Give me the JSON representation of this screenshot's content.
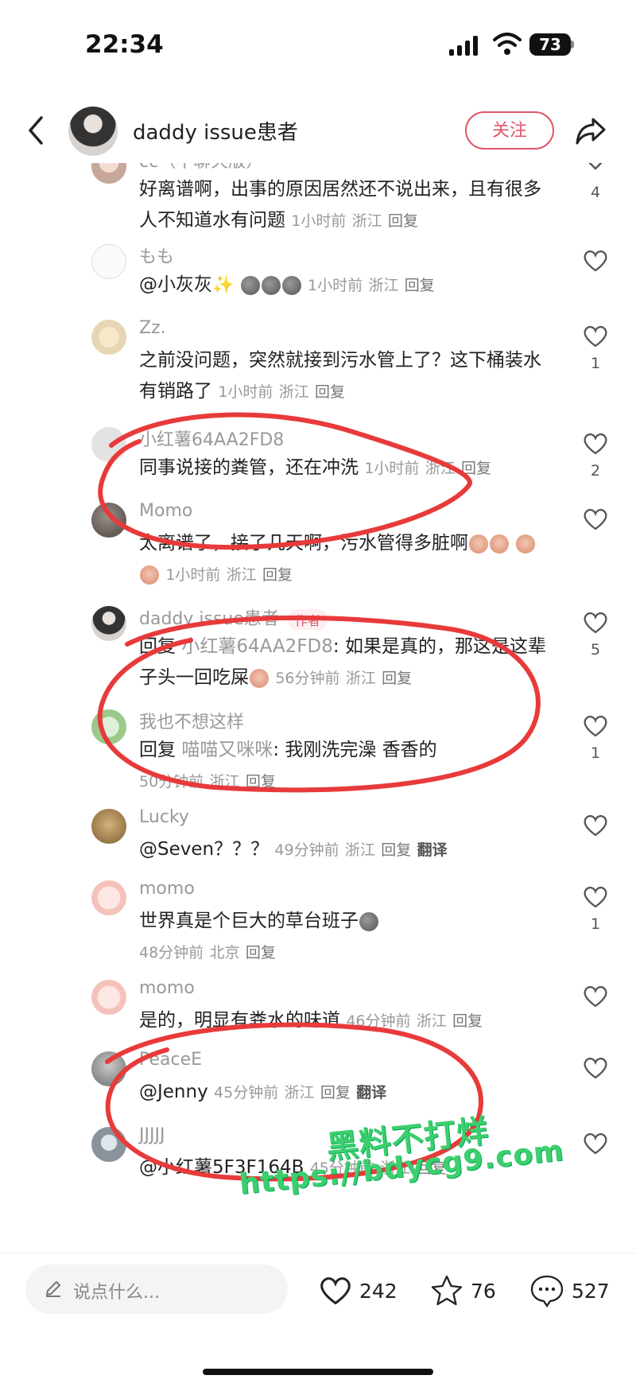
{
  "status_bar": {
    "time": "22:34",
    "battery": "73"
  },
  "header": {
    "username": "daddy issue患者",
    "follow_label": "关注"
  },
  "comments": [
    {
      "user": "cc（不聊天版）",
      "text": "好离谱啊，出事的原因居然还不说出来，且有很多人不知道水有问题",
      "time": "1小时前",
      "location": "浙江",
      "reply": "回复",
      "likes": "4"
    },
    {
      "user": "もも",
      "mention": "@小灰灰",
      "time": "1小时前",
      "location": "浙江",
      "reply": "回复",
      "likes": ""
    },
    {
      "user": "Zz.",
      "text": "之前没问题，突然就接到污水管上了？这下桶装水有销路了",
      "time": "1小时前",
      "location": "浙江",
      "reply": "回复",
      "likes": "1"
    },
    {
      "user": "小红薯64AA2FD8",
      "text": "同事说接的粪管，还在冲洗",
      "time": "1小时前",
      "location": "浙江",
      "reply": "回复",
      "likes": "2"
    },
    {
      "user": "Momo",
      "text": "太离谱了，接了几天啊，污水管得多脏啊",
      "time": "1小时前",
      "location": "浙江",
      "reply": "回复",
      "likes": ""
    },
    {
      "user": "daddy issue患者",
      "tag": "作者",
      "reply_prefix": "回复",
      "reply_to": "小红薯64AA2FD8",
      "text": ": 如果是真的，那这是这辈子头一回吃屎",
      "time": "56分钟前",
      "location": "浙江",
      "reply": "回复",
      "likes": "5"
    },
    {
      "user": "我也不想这样",
      "reply_prefix": "回复",
      "reply_to": "喵喵又咪咪",
      "text": ": 我刚洗完澡 香香的",
      "time": "50分钟前",
      "location": "浙江",
      "reply": "回复",
      "likes": "1"
    },
    {
      "user": "Lucky",
      "text": "@Seven？？？",
      "time": "49分钟前",
      "location": "浙江",
      "reply": "回复",
      "translate": "翻译",
      "likes": ""
    },
    {
      "user": "momo",
      "text": "世界真是个巨大的草台班子",
      "time": "48分钟前",
      "location": "北京",
      "reply": "回复",
      "likes": "1"
    },
    {
      "user": "momo",
      "text": "是的，明显有粪水的味道",
      "time": "46分钟前",
      "location": "浙江",
      "reply": "回复",
      "likes": ""
    },
    {
      "user": "PeaceE",
      "text": "@Jenny",
      "time": "45分钟前",
      "location": "浙江",
      "reply": "回复",
      "translate": "翻译",
      "likes": ""
    },
    {
      "user": "JJJJJ",
      "text": "@小红薯5F3F164B",
      "time": "45分钟前",
      "location": "浙江",
      "reply": "回复",
      "likes": ""
    }
  ],
  "bottom_bar": {
    "input_placeholder": "说点什么...",
    "likes": "242",
    "stars": "76",
    "comments": "527"
  },
  "watermark": {
    "line1": "黑料不打烊",
    "line2": "https://bdycg9.com"
  },
  "colors": {
    "accent": "#e0566a",
    "annotation": "#e83a3a",
    "watermark": "#3ccf6e"
  }
}
